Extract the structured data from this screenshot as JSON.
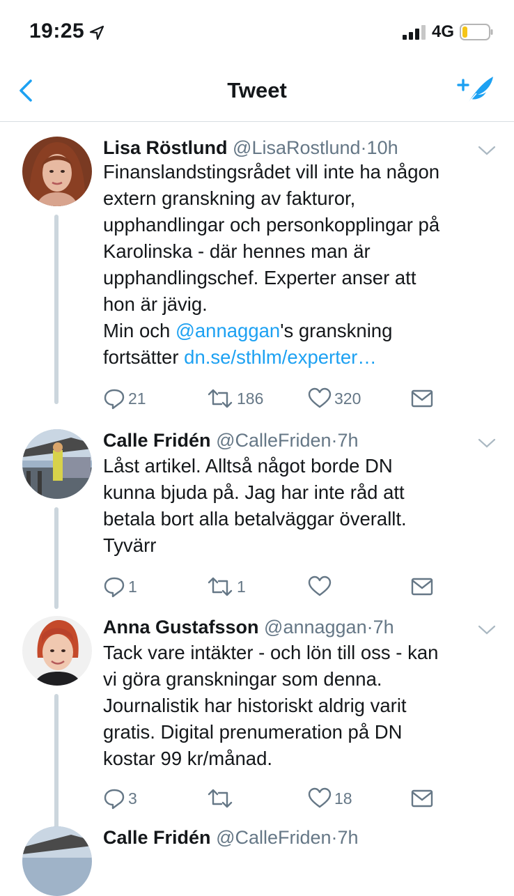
{
  "status_bar": {
    "time": "19:25",
    "network": "4G",
    "icons": [
      "location-arrow-icon",
      "signal-bars-icon",
      "battery-low-icon"
    ]
  },
  "nav": {
    "title": "Tweet",
    "back_icon": "chevron-left-icon",
    "compose_icon": "compose-tweet-icon"
  },
  "colors": {
    "accent": "#1da1f2",
    "text": "#14171a",
    "secondary": "#657786",
    "thread": "#ccd6dd",
    "battery": "#f5c518"
  },
  "tweets": [
    {
      "name": "Lisa Röstlund",
      "handle": "@LisaRostlund",
      "sep": "·",
      "time": "10h",
      "lines": [
        "Finanslandstingsrådet vill inte ha någon",
        "extern granskning av fakturor,",
        "upphandlingar och personkopplingar på",
        "Karolinska - där hennes man är",
        "upphandlingschef. Experter anser att",
        "hon är jävig."
      ],
      "line7_pre": "Min och ",
      "mention": "@annaggan",
      "line7_post": "'s granskning",
      "line8_pre": "fortsätter ",
      "url": "dn.se/sthlm/experter…",
      "replies": "21",
      "retweets": "186",
      "likes": "320"
    },
    {
      "name": "Calle Fridén",
      "handle": "@CalleFriden",
      "sep": "·",
      "time": "7h",
      "lines": [
        "Låst artikel. Alltså något borde DN",
        "kunna bjuda på. Jag har inte råd att",
        "betala bort alla betalväggar överallt.",
        "Tyvärr"
      ],
      "replies": "1",
      "retweets": "1",
      "likes": ""
    },
    {
      "name": "Anna Gustafsson",
      "handle": "@annaggan",
      "sep": "·",
      "time": "7h",
      "lines": [
        "Tack vare intäkter - och lön till oss - kan",
        "vi göra granskningar som denna.",
        "Journalistik har historiskt aldrig varit",
        "gratis. Digital prenumeration på DN",
        "kostar 99 kr/månad."
      ],
      "replies": "3",
      "retweets": "",
      "likes": "18"
    },
    {
      "name": "Calle Fridén",
      "handle": "@CalleFriden",
      "sep": "·",
      "time": "7h"
    }
  ]
}
